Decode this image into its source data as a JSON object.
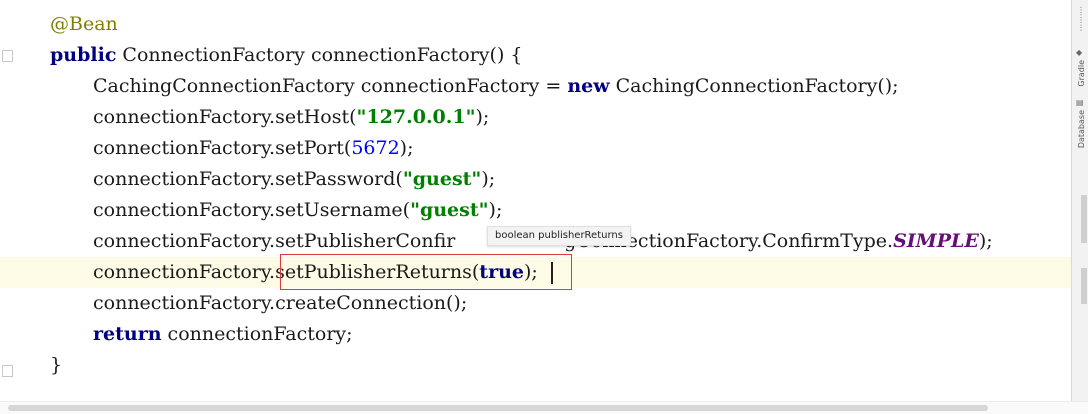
{
  "editor": {
    "lines": [
      [
        {
          "t": "@Bean",
          "c": "ann"
        }
      ],
      [
        {
          "t": "public",
          "c": "kw"
        },
        {
          "t": " ConnectionFactory connectionFactory() {",
          "c": ""
        }
      ],
      [
        {
          "t": "CachingConnectionFactory connectionFactory = ",
          "c": ""
        },
        {
          "t": "new",
          "c": "kw"
        },
        {
          "t": " CachingConnectionFactory();",
          "c": ""
        }
      ],
      [
        {
          "t": "connectionFactory.setHost(",
          "c": ""
        },
        {
          "t": "\"127.0.0.1\"",
          "c": "str"
        },
        {
          "t": ");",
          "c": ""
        }
      ],
      [
        {
          "t": "connectionFactory.setPort(",
          "c": ""
        },
        {
          "t": "5672",
          "c": "num"
        },
        {
          "t": ");",
          "c": ""
        }
      ],
      [
        {
          "t": "connectionFactory.setPassword(",
          "c": ""
        },
        {
          "t": "\"guest\"",
          "c": "str"
        },
        {
          "t": ");",
          "c": ""
        }
      ],
      [
        {
          "t": "connectionFactory.setUsername(",
          "c": ""
        },
        {
          "t": "\"guest\"",
          "c": "str"
        },
        {
          "t": ");",
          "c": ""
        }
      ],
      [
        {
          "t": "connectionFactory.setPublisherConfir",
          "c": ""
        },
        {
          "t": "                  ",
          "c": ""
        },
        {
          "t": "gConnectionFactory.ConfirmType.",
          "c": ""
        },
        {
          "t": "SIMPLE",
          "c": "const"
        },
        {
          "t": ");",
          "c": ""
        }
      ],
      [
        {
          "t": "connectionFactory.",
          "c": ""
        },
        {
          "t": "setPublisherReturns(",
          "c": ""
        },
        {
          "t": "true",
          "c": "kw"
        },
        {
          "t": ");",
          "c": ""
        }
      ],
      [
        {
          "t": "connectionFactory.createConnection();",
          "c": ""
        }
      ],
      [
        {
          "t": "return",
          "c": "kw"
        },
        {
          "t": " connectionFactory;",
          "c": ""
        }
      ],
      [
        {
          "t": "}",
          "c": ""
        }
      ]
    ],
    "indents": [
      0,
      0,
      1,
      1,
      1,
      1,
      1,
      1,
      1,
      1,
      1,
      0
    ],
    "current_line": 8
  },
  "param_hint": "boolean publisherReturns",
  "side_panel": {
    "tabs": [
      "Gradle",
      "Database"
    ]
  }
}
